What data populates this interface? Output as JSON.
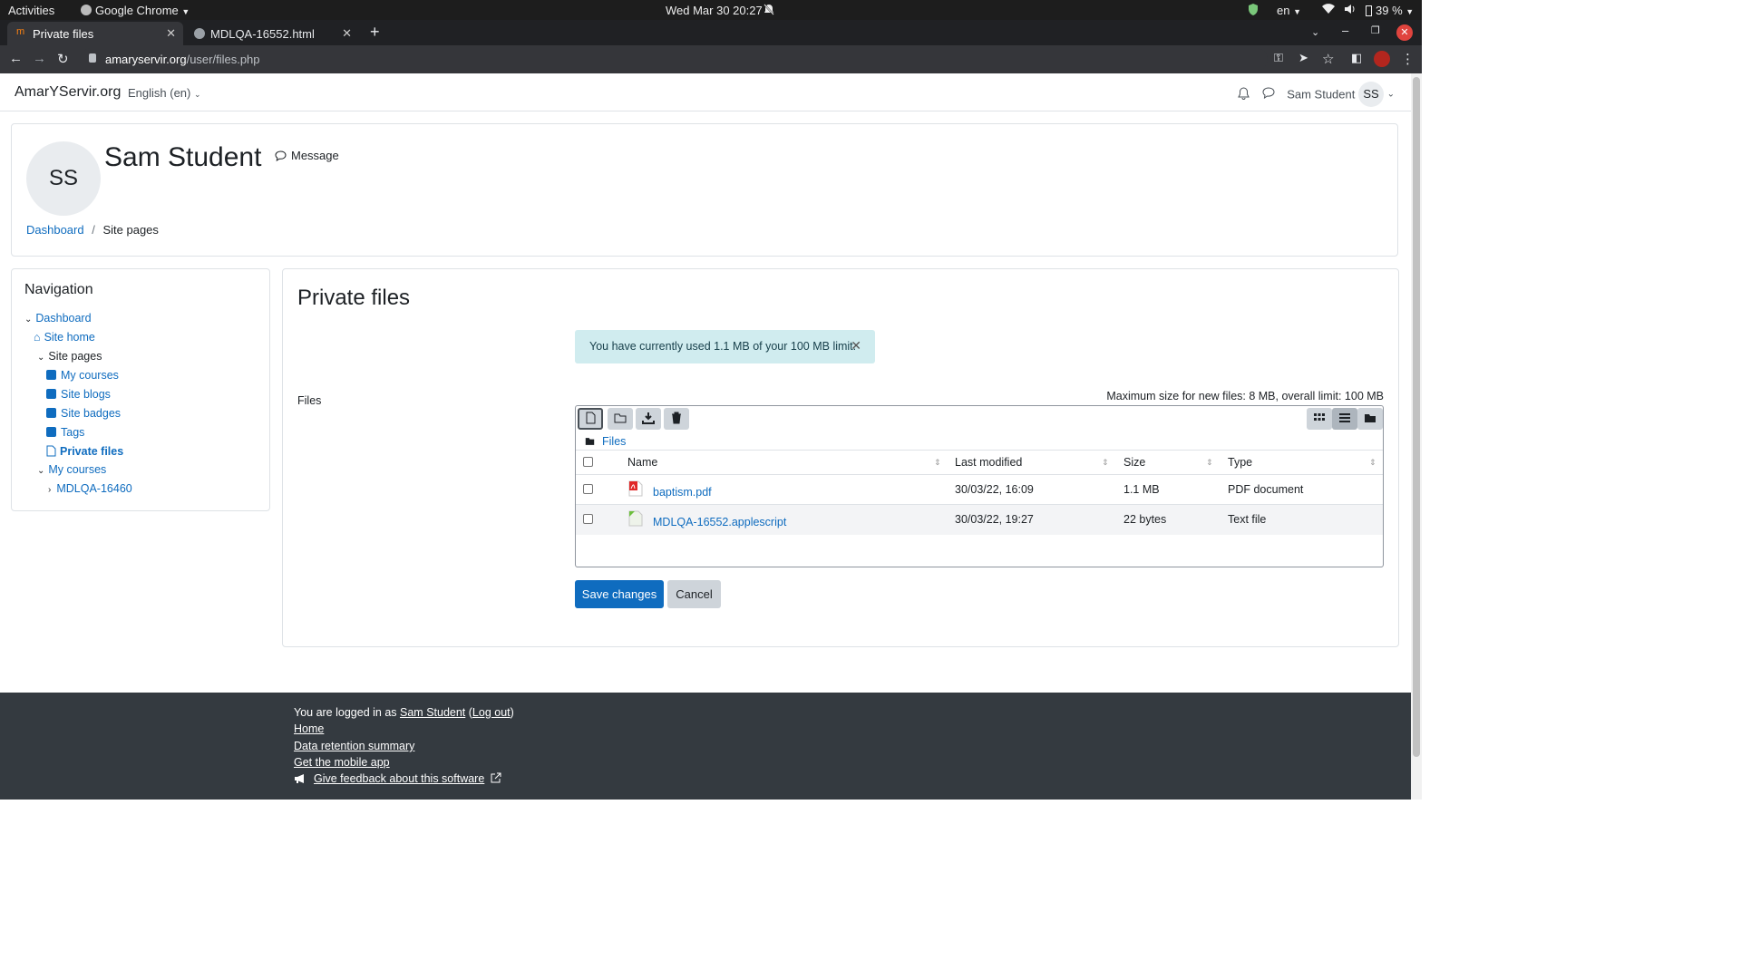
{
  "os": {
    "activities": "Activities",
    "app": "Google Chrome",
    "clock": "Wed Mar 30  20:27",
    "lang": "en",
    "battery": "39 %"
  },
  "tabs": [
    {
      "label": "Private files"
    },
    {
      "label": "MDLQA-16552.html"
    }
  ],
  "address": {
    "domain": "amaryservir.org",
    "path": "/user/files.php"
  },
  "site": {
    "brand": "AmarYServir.org",
    "language": "English (en)",
    "user_name": "Sam Student",
    "user_initials": "SS"
  },
  "header": {
    "initials": "SS",
    "name": "Sam Student",
    "message_label": "Message",
    "breadcrumb": [
      "Dashboard",
      "Site pages"
    ]
  },
  "navigation": {
    "title": "Navigation",
    "items": [
      {
        "label": "Dashboard"
      },
      {
        "label": "Site home"
      },
      {
        "label": "Site pages"
      },
      {
        "label": "My courses"
      },
      {
        "label": "Site blogs"
      },
      {
        "label": "Site badges"
      },
      {
        "label": "Tags"
      },
      {
        "label": "Private files"
      },
      {
        "label": "My courses"
      },
      {
        "label": "MDLQA-16460"
      }
    ]
  },
  "main": {
    "title": "Private files",
    "alert": "You have currently used 1.1 MB of your 100 MB limit.",
    "files_label": "Files",
    "max_size": "Maximum size for new files: 8 MB, overall limit: 100 MB",
    "path": "Files",
    "columns": [
      "Name",
      "Last modified",
      "Size",
      "Type"
    ],
    "files": [
      {
        "name": "baptism.pdf",
        "modified": "30/03/22, 16:09",
        "size": "1.1 MB",
        "type": "PDF document"
      },
      {
        "name": "MDLQA-16552.applescript",
        "modified": "30/03/22, 19:27",
        "size": "22 bytes",
        "type": "Text file"
      }
    ],
    "save_label": "Save changes",
    "cancel_label": "Cancel"
  },
  "footer": {
    "logged_prefix": "You are logged in as",
    "logged_user": "Sam Student",
    "logout": "Log out",
    "links": [
      "Home",
      "Data retention summary",
      "Get the mobile app"
    ],
    "feedback": "Give feedback about this software"
  },
  "colors": {
    "primary": "#0f6cbf",
    "footer_bg": "#343a40",
    "alert_bg": "#d0ecef"
  }
}
